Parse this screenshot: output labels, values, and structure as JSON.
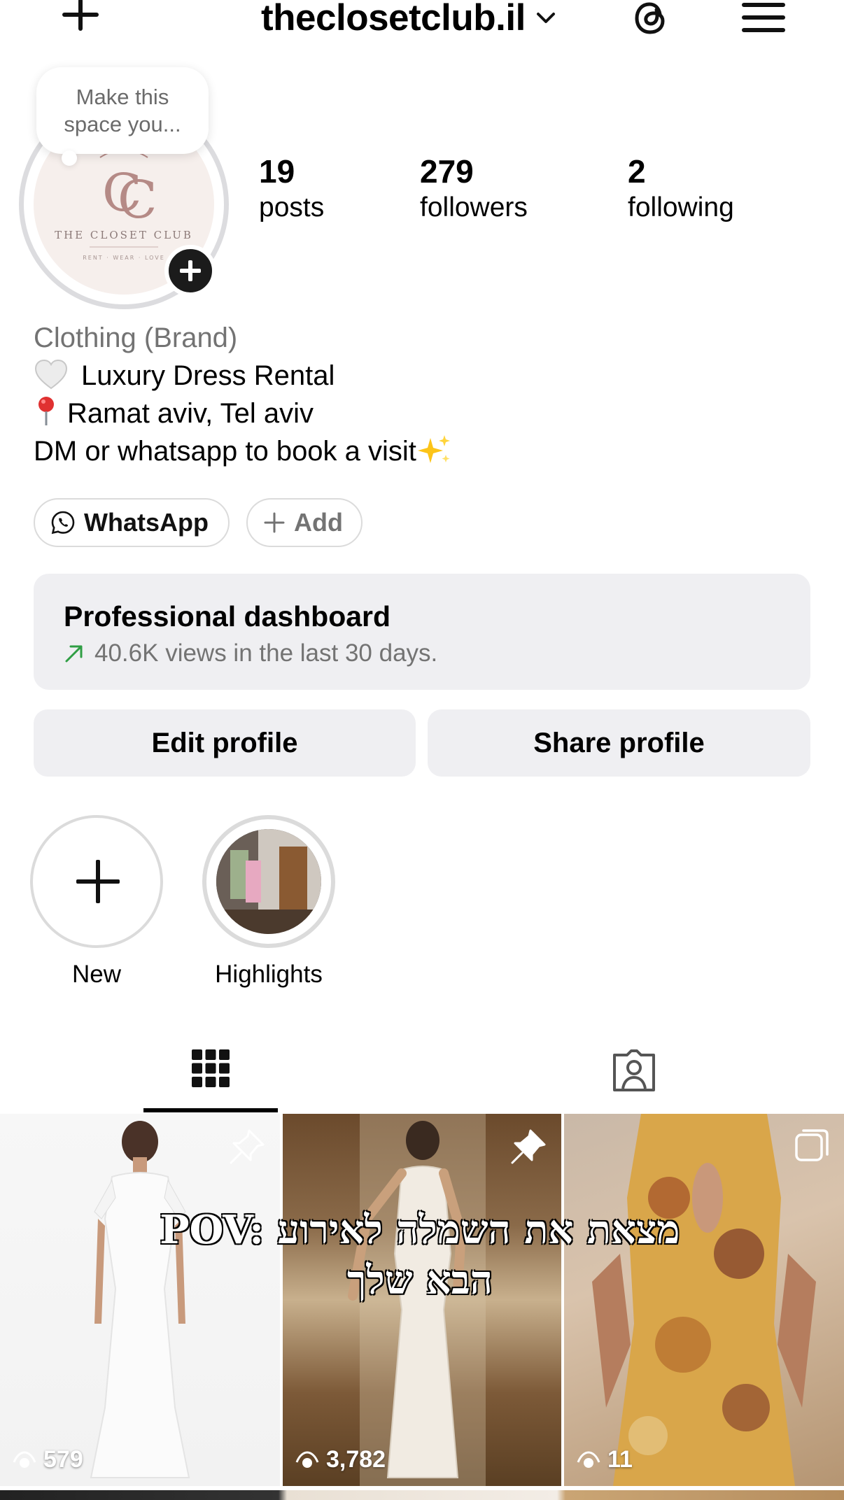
{
  "header": {
    "username": "theclosetclub.il",
    "icons": [
      "plus-icon",
      "chevron-down-icon",
      "threads-icon",
      "menu-icon"
    ]
  },
  "note": {
    "text": "Make this space you..."
  },
  "avatar": {
    "logo_text": "THE CLOSET CLUB",
    "tagline": "RENT · WEAR · LOVE"
  },
  "stats": {
    "posts": {
      "value": "19",
      "label": "posts"
    },
    "followers": {
      "value": "279",
      "label": "followers"
    },
    "following": {
      "value": "2",
      "label": "following"
    }
  },
  "bio": {
    "category": "Clothing (Brand)",
    "line1": "Luxury Dress Rental",
    "line2": "Ramat aviv, Tel aviv",
    "line3": "DM or whatsapp to book a visit"
  },
  "links": {
    "whatsapp": "WhatsApp",
    "add": "Add"
  },
  "dashboard": {
    "title": "Professional dashboard",
    "subtitle": "40.6K views in the last 30 days."
  },
  "actions": {
    "edit": "Edit profile",
    "share": "Share profile"
  },
  "highlights": [
    {
      "label": "New"
    },
    {
      "label": "Highlights"
    }
  ],
  "posts": [
    {
      "views": "579",
      "badge": "pin-icon"
    },
    {
      "views": "3,782",
      "badge": "pin-icon"
    },
    {
      "views": "11",
      "badge": "carousel-icon"
    }
  ],
  "post_overlay": {
    "line1": "POV: מצאת את השמלה לאירוע",
    "line2": "הבא שלך"
  },
  "colors": {
    "secondary_text": "#737373",
    "button_bg": "#efeff2",
    "accent_green": "#2f9e44"
  }
}
